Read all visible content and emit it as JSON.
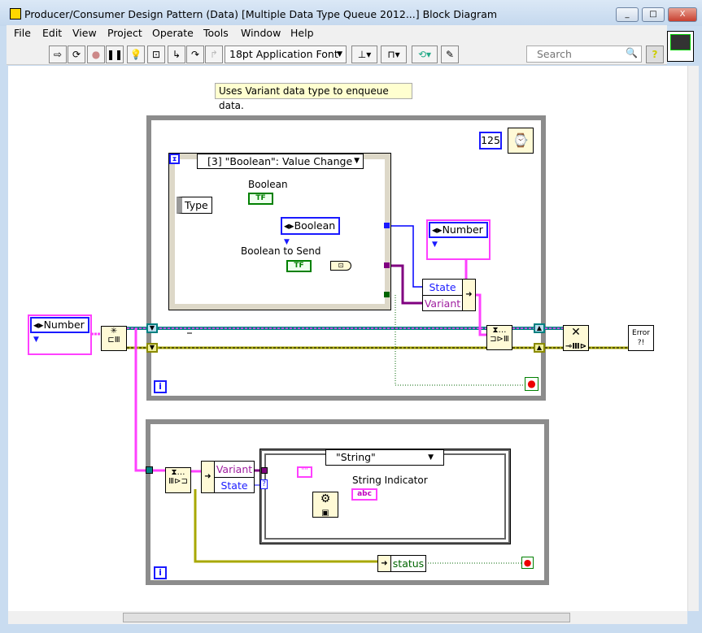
{
  "window": {
    "title": "Producer/Consumer Design Pattern (Data) [Multiple Data Type Queue 2012...] Block Diagram"
  },
  "menu": [
    "File",
    "Edit",
    "View",
    "Project",
    "Operate",
    "Tools",
    "Window",
    "Help"
  ],
  "toolbar": {
    "font": "18pt Application Font",
    "search_placeholder": "Search",
    "help": "?"
  },
  "annotation": "Uses Variant data type to enqueue data.",
  "producer": {
    "wait_ms": "125",
    "event_selector": "[3] \"Boolean\": Value Change",
    "event_data": "Type",
    "boolean_label": "Boolean",
    "enum_const": "Boolean",
    "boolean_to_send_label": "Boolean to Send",
    "tf": "TF",
    "typedef_const": "Number",
    "bundle_items": [
      "State",
      "Variant"
    ],
    "iteration": "i"
  },
  "left_typedef": "Number",
  "error_handler": "Error ?!",
  "consumer": {
    "unbundle_items": [
      "Variant",
      "State"
    ],
    "case_selector": "\"String\"",
    "string_const": "\"\"",
    "string_indicator_label": "String Indicator",
    "string_terminal": "abc",
    "status": "status",
    "iteration": "i",
    "unknown_tunnel": "?"
  },
  "colors": {
    "queue_wire": "#ff40ff",
    "refnum_wire": "#008080",
    "error_wire": "#c8c800",
    "enum_wire": "#0000ff",
    "variant_wire": "#800080"
  }
}
